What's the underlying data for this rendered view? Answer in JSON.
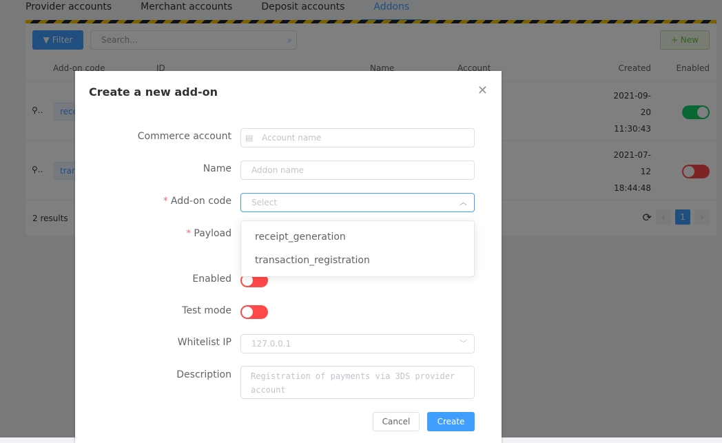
{
  "tabs": [
    "Provider accounts",
    "Merchant accounts",
    "Deposit accounts",
    "Addons"
  ],
  "toolbar": {
    "filter": "Filter",
    "search_placeholder": "Search...",
    "new": "+ New"
  },
  "table": {
    "headers": [
      "Add-on code",
      "ID",
      "Name",
      "Account",
      "Created",
      "Enabled"
    ],
    "rows": [
      {
        "code": "receipt_generation",
        "date1": "2021-09-",
        "date2": "20",
        "date3": "11:30:43",
        "enabled": true
      },
      {
        "code": "transaction_registration",
        "date1": "2021-07-",
        "date2": "12",
        "date3": "18:44:48",
        "enabled": false
      }
    ],
    "results": "2 results",
    "page": "1"
  },
  "modal": {
    "title": "Create a new add-on",
    "fields": {
      "commerce_account": "Commerce account",
      "account_placeholder": "Account name",
      "name": "Name",
      "name_placeholder": "Addon name",
      "code": "Add-on code",
      "code_placeholder": "Select",
      "payload": "Payload",
      "enabled": "Enabled",
      "test_mode": "Test mode",
      "whitelist": "Whitelist IP",
      "whitelist_placeholder": "127.0.0.1",
      "description": "Description",
      "description_placeholder": "Registration of payments via 3DS provider account"
    },
    "options": [
      "receipt_generation",
      "transaction_registration"
    ],
    "cancel": "Cancel",
    "create": "Create",
    "enabled_value": false,
    "test_mode_value": false
  },
  "colors": {
    "primary": "#409eff",
    "success": "#13ce66",
    "danger": "#ff4949"
  }
}
